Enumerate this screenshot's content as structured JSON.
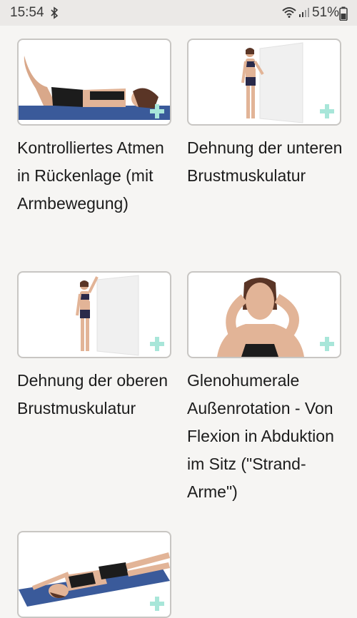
{
  "status_bar": {
    "time": "15:54",
    "battery": "51%",
    "icons": [
      "bluetooth-icon",
      "wifi-icon",
      "signal-icon",
      "battery-icon"
    ]
  },
  "exercises": [
    {
      "title": "Kontrolliertes Atmen in Rückenlage (mit Armbewegung)"
    },
    {
      "title": "Dehnung der unteren Brustmuskulatur"
    },
    {
      "title": "Dehnung der oberen Brustmuskulatur"
    },
    {
      "title": "Glenohumerale Außenrotation - Von Flexion in Abduktion im Sitz (\"Strand-Arme\")"
    },
    {
      "title": ""
    }
  ],
  "colors": {
    "background": "#f6f5f3",
    "card_border": "#c8c6c3",
    "add_icon": "#a8e6d9",
    "mat": "#3a5a9a"
  }
}
